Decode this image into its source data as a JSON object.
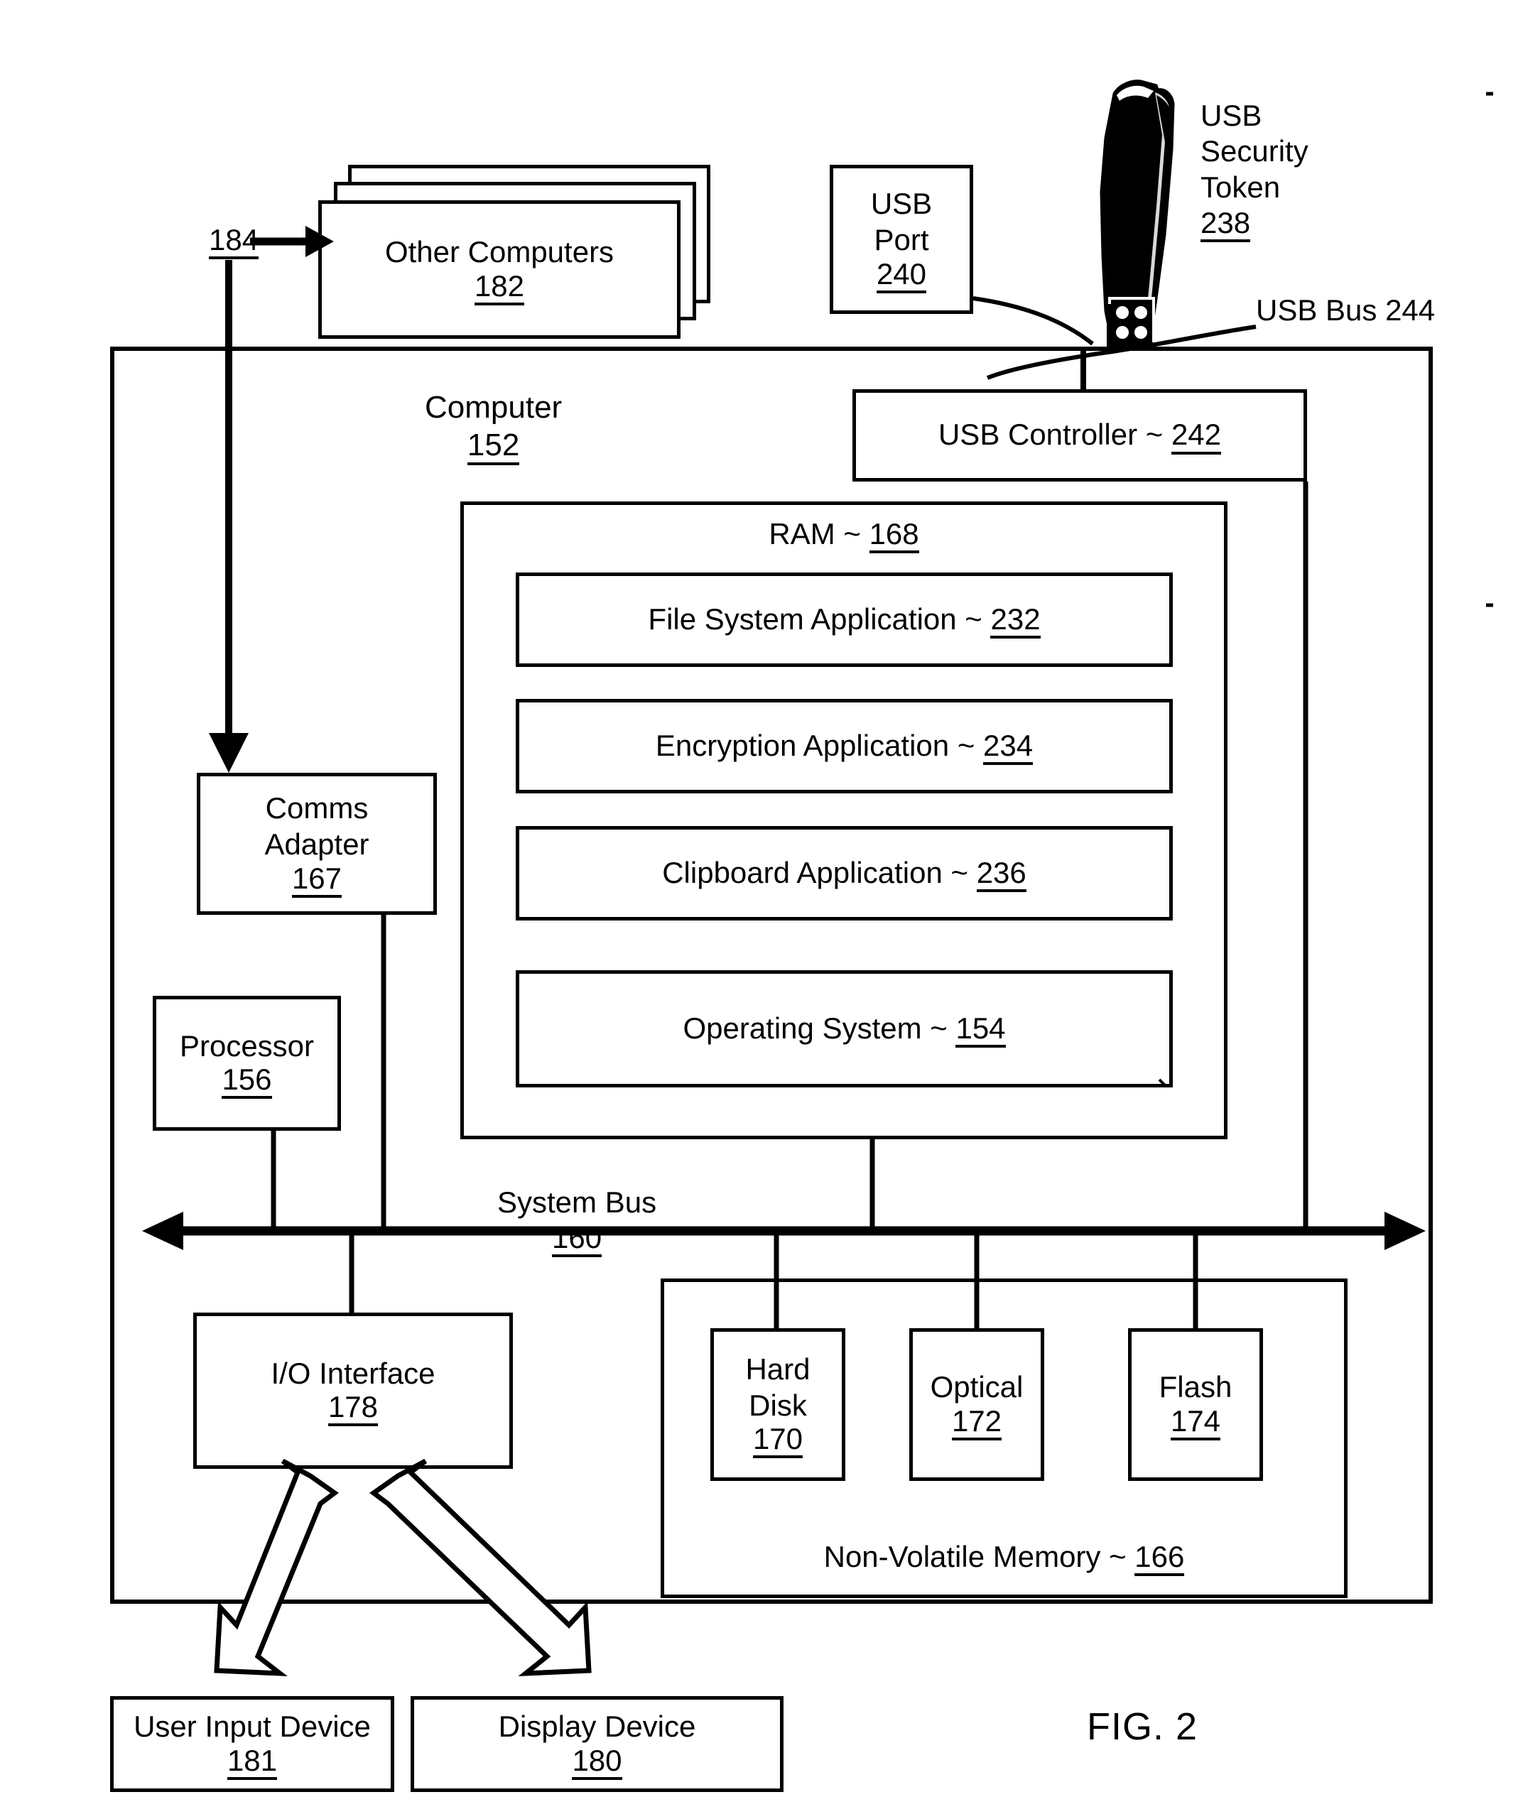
{
  "figure": {
    "caption": "FIG. 2"
  },
  "external": {
    "other_computers": {
      "label": "Other Computers",
      "ref": "182"
    },
    "network_ref": "184",
    "usb_port": {
      "line1": "USB",
      "line2": "Port",
      "ref": "240"
    },
    "usb_security_token": {
      "line1": "USB",
      "line2": "Security",
      "line3": "Token",
      "ref": "238"
    },
    "usb_bus_label": "USB Bus 244"
  },
  "computer": {
    "label": "Computer",
    "ref": "152",
    "usb_controller": {
      "label": "USB Controller  ~",
      "ref": "242"
    },
    "ram": {
      "label": "RAM ~",
      "ref": "168",
      "modules": [
        {
          "label": "File System Application ~",
          "ref": "232"
        },
        {
          "label": "Encryption Application ~",
          "ref": "234"
        },
        {
          "label": "Clipboard Application ~",
          "ref": "236"
        },
        {
          "label": "Operating System ~",
          "ref": "154"
        }
      ]
    },
    "comms_adapter": {
      "line1": "Comms",
      "line2": "Adapter",
      "ref": "167"
    },
    "processor": {
      "label": "Processor",
      "ref": "156"
    },
    "system_bus": {
      "label": "System Bus",
      "ref": "160"
    },
    "io_interface": {
      "label": "I/O Interface",
      "ref": "178"
    },
    "non_volatile_memory": {
      "label": "Non-Volatile Memory ~",
      "ref": "166",
      "devices": [
        {
          "line1": "Hard",
          "line2": "Disk",
          "ref": "170"
        },
        {
          "line1": "Optical",
          "ref": "172"
        },
        {
          "line1": "Flash",
          "ref": "174"
        }
      ]
    }
  },
  "peripherals": {
    "user_input_device": {
      "label": "User Input Device",
      "ref": "181"
    },
    "display_device": {
      "label": "Display Device",
      "ref": "180"
    }
  },
  "colors": {
    "ink": "#000000",
    "paper": "#ffffff"
  }
}
